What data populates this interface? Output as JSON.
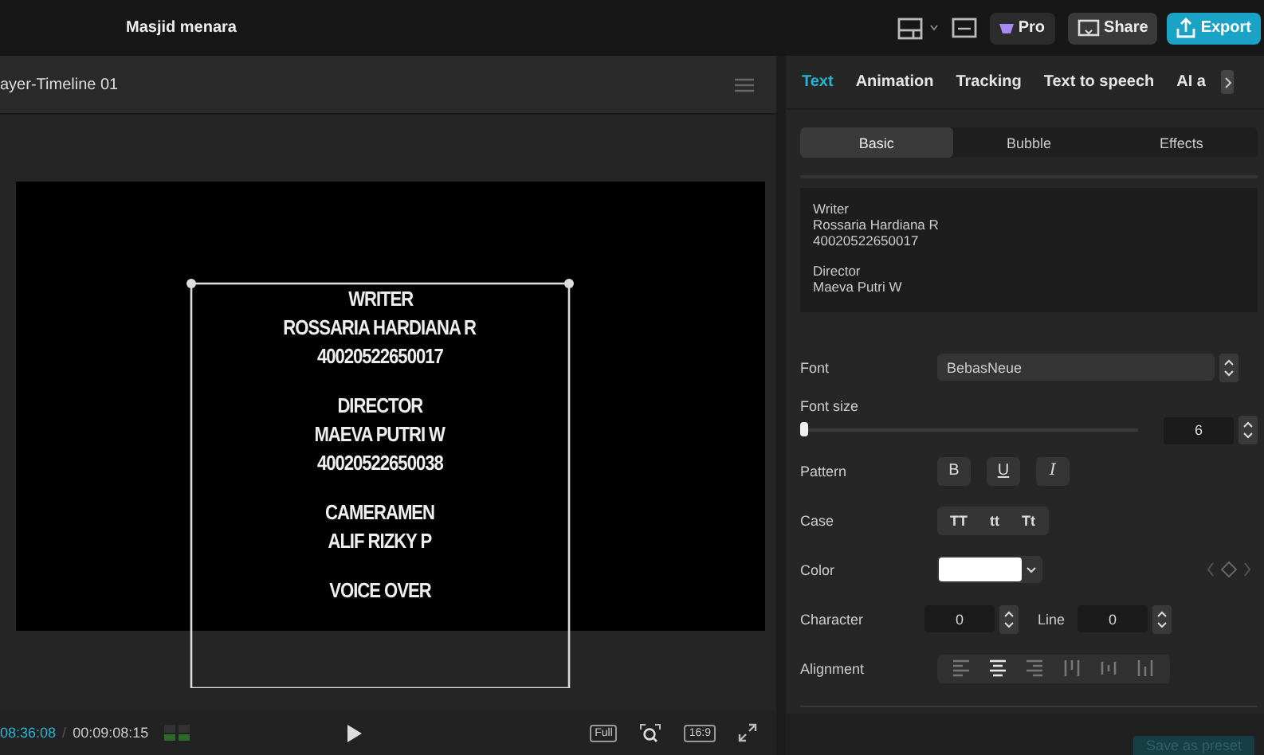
{
  "top_bar": {
    "project_title": "Masjid menara",
    "buttons": [
      {
        "kind": "pro",
        "label": "Pro"
      },
      {
        "kind": "share",
        "label": "Share"
      },
      {
        "kind": "export",
        "label": "Export"
      }
    ]
  },
  "player": {
    "title": "ayer-Timeline 01",
    "credits": [
      [
        "WRITER",
        "ROSSARIA HARDIANA R",
        "40020522650017"
      ],
      [
        "DIRECTOR",
        "MAEVA PUTRI W",
        "40020522650038"
      ],
      [
        "CAMERAMEN",
        "ALIF RIZKY P"
      ],
      [
        "VOICE OVER"
      ]
    ],
    "time_current": "08:36:08",
    "time_separator": "/",
    "time_total": "00:09:08:15",
    "view_buttons": [
      {
        "kind": "full",
        "label": "Full"
      },
      {
        "kind": "zoom"
      },
      {
        "kind": "ratio",
        "label": "16:9"
      },
      {
        "kind": "fullscreen"
      }
    ]
  },
  "panel": {
    "tabs": [
      {
        "label": "Text",
        "selected": true
      },
      {
        "label": "Animation",
        "selected": false
      },
      {
        "label": "Tracking",
        "selected": false
      },
      {
        "label": "Text to speech",
        "selected": false
      },
      {
        "label": "AI a",
        "selected": false
      }
    ],
    "subtabs": [
      {
        "label": "Basic",
        "selected": true
      },
      {
        "label": "Bubble",
        "selected": false
      },
      {
        "label": "Effects",
        "selected": false
      }
    ],
    "text_content": [
      [
        "Writer",
        "Rossaria Hardiana R",
        "40020522650017"
      ],
      [
        "Director",
        "Maeva Putri W"
      ]
    ],
    "font": {
      "label": "Font",
      "value": "BebasNeue"
    },
    "font_size": {
      "label": "Font size",
      "level": 0.0,
      "value": "6"
    },
    "pattern": {
      "label": "Pattern",
      "buttons": [
        {
          "kind": "bold",
          "label": "B"
        },
        {
          "kind": "underline",
          "label": "U"
        },
        {
          "kind": "italic",
          "label": "I"
        }
      ]
    },
    "case": {
      "label": "Case",
      "options": [
        "TT",
        "tt",
        "Tt"
      ]
    },
    "color": {
      "label": "Color",
      "color": "#ffffff"
    },
    "character": {
      "label": "Character",
      "value": "0"
    },
    "line": {
      "label": "Line",
      "value": "0"
    },
    "alignment": {
      "label": "Alignment",
      "options": [
        {
          "kind": "left",
          "selected": false
        },
        {
          "kind": "center",
          "selected": true
        },
        {
          "kind": "right",
          "selected": false
        },
        {
          "kind": "top",
          "selected": false
        },
        {
          "kind": "middle",
          "selected": false
        },
        {
          "kind": "bottom",
          "selected": false
        }
      ]
    },
    "save_button": "Save as preset"
  }
}
